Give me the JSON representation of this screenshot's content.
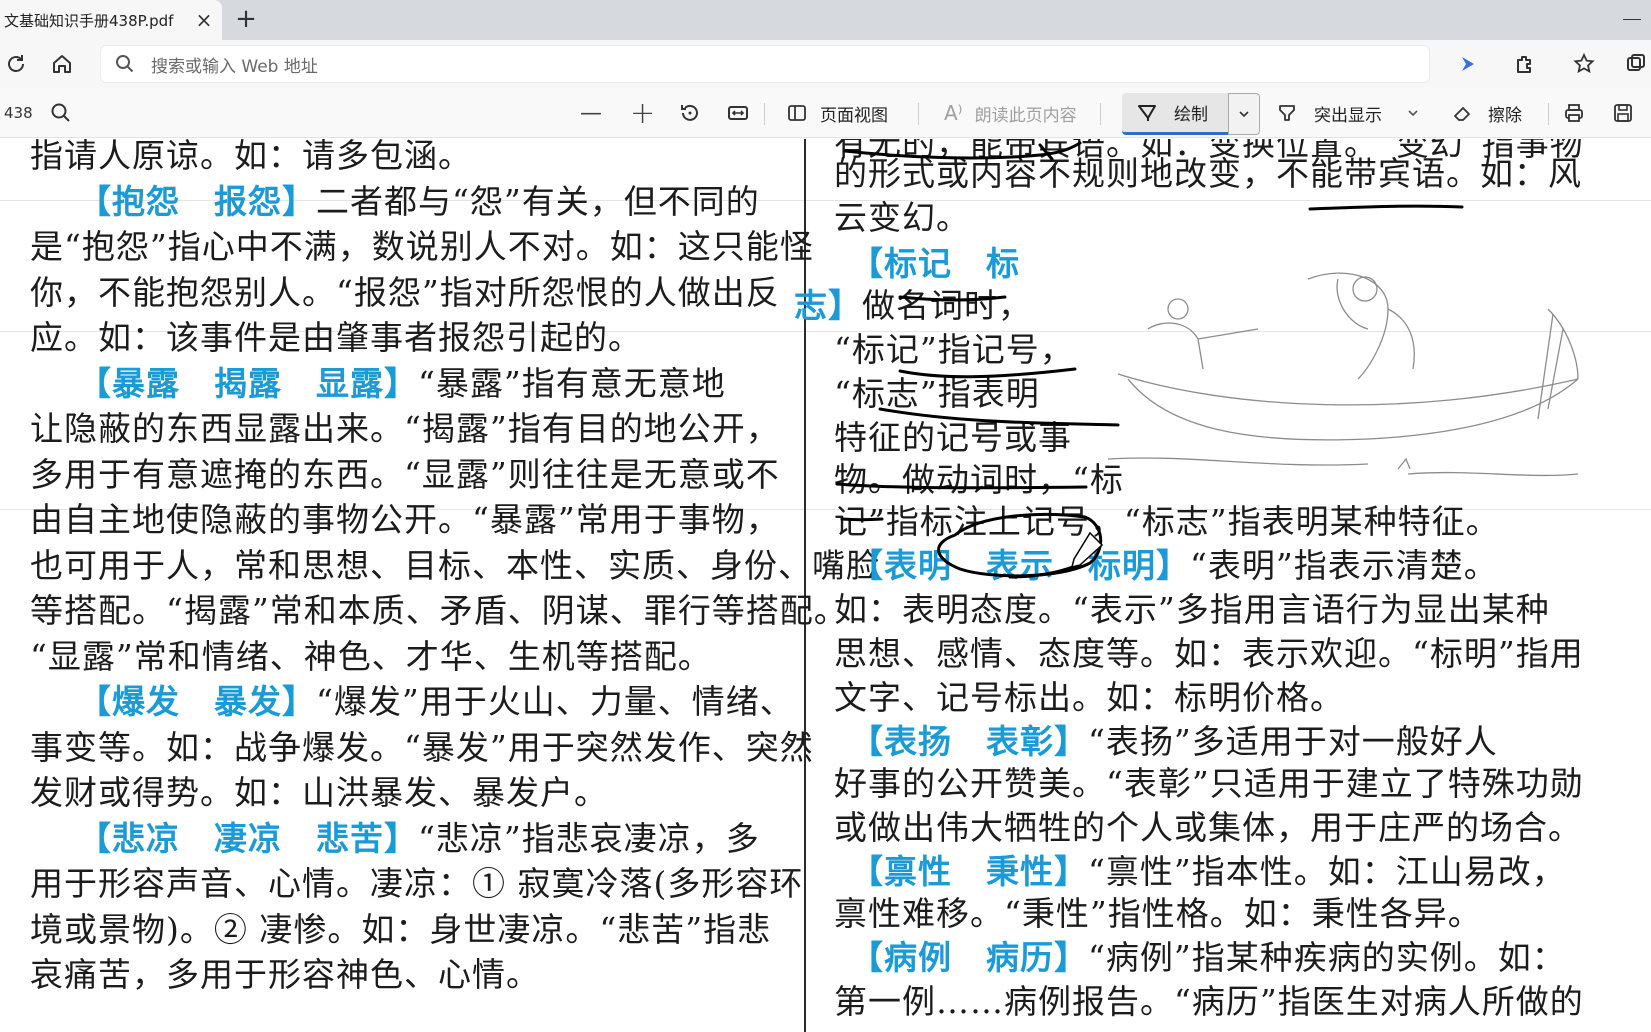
{
  "tab": {
    "title": "文基础知识手册438P.pdf",
    "close": "×",
    "new_tab": "+"
  },
  "address": {
    "placeholder": "搜索或输入 Web 地址"
  },
  "pdf_toolbar": {
    "page_count": "438",
    "zoom_out": "—",
    "zoom_in": "+",
    "page_view": "页面视图",
    "read_aloud": "朗读此页内容",
    "draw": "绘制",
    "highlight": "突出显示",
    "erase": "擦除"
  },
  "left_column": [
    {
      "text": "指请人原谅。如：请多包涵。"
    },
    {
      "head": "【抱怨　报怨】",
      "text": "二者都与“怨”有关，但不同的"
    },
    {
      "text": "是“抱怨”指心中不满，数说别人不对。如：这只能怪"
    },
    {
      "text": "你，不能抱怨别人。“报怨”指对所怨恨的人做出反"
    },
    {
      "text": "应。如：该事件是由肇事者报怨引起的。"
    },
    {
      "head": "【暴露　揭露　显露】",
      "text": "“暴露”指有意无意地"
    },
    {
      "text": "让隐蔽的东西显露出来。“揭露”指有目的地公开，"
    },
    {
      "text": "多用于有意遮掩的东西。“显露”则往往是无意或不"
    },
    {
      "text": "由自主地使隐蔽的事物公开。“暴露”常用于事物，"
    },
    {
      "text": "也可用于人，常和思想、目标、本性、实质、身份、嘴脸"
    },
    {
      "text": "等搭配。“揭露”常和本质、矛盾、阴谋、罪行等搭配。"
    },
    {
      "text": "“显露”常和情绪、神色、才华、生机等搭配。"
    },
    {
      "head": "【爆发　暴发】",
      "text": "“爆发”用于火山、力量、情绪、"
    },
    {
      "text": "事变等。如：战争爆发。“暴发”用于突然发作、突然"
    },
    {
      "text": "发财或得势。如：山洪暴发、暴发户。"
    },
    {
      "head": "【悲凉　凄凉　悲苦】",
      "text": "“悲凉”指悲哀凄凉，多"
    },
    {
      "text": "用于形容声音、心情。凄凉：① 寂寞冷落(多形容环"
    },
    {
      "text": "境或景物)。② 凄惨。如：身世凄凉。“悲苦”指悲"
    },
    {
      "text": "哀痛苦，多用于形容神色、心情。"
    }
  ],
  "right_column": [
    {
      "text": "有无的，能带宾语。如：变换位置。“变幻”指事物"
    },
    {
      "text": "的形式或内容不规则地改变，不能带宾语。如：风"
    },
    {
      "text": "云变幻。"
    },
    {
      "head": "【标记　标",
      "text": ""
    },
    {
      "head": "志】",
      "text": "做名词时，"
    },
    {
      "text": "“标记”指记号，"
    },
    {
      "text": "“标志”指表明"
    },
    {
      "text": "特征的记号或事"
    },
    {
      "text": "物。做动词时，“标"
    },
    {
      "text": "记”指标注上记号，“标志”指表明某种特征。"
    },
    {
      "head": "【表明　表示　标明】",
      "text": "“表明”指表示清楚。"
    },
    {
      "text": "如：表明态度。“表示”多指用言语行为显出某种"
    },
    {
      "text": "思想、感情、态度等。如：表示欢迎。“标明”指用"
    },
    {
      "text": "文字、记号标出。如：标明价格。"
    },
    {
      "head": "【表扬　表彰】",
      "text": "“表扬”多适用于对一般好人"
    },
    {
      "text": "好事的公开赞美。“表彰”只适用于建立了特殊功勋"
    },
    {
      "text": "或做出伟大牺牲的个人或集体，用于庄严的场合。"
    },
    {
      "head": "【禀性　秉性】",
      "text": "“禀性”指本性。如：江山易改，"
    },
    {
      "text": "禀性难移。“秉性”指性格。如：秉性各异。"
    },
    {
      "head": "【病例　病历】",
      "text": "“病例”指某种疾病的实例。如："
    },
    {
      "text": "第一例……病例报告。“病历”指医生对病人所做的"
    }
  ],
  "colors": {
    "heading": "#1a9bd7",
    "ink": "#000000",
    "accent": "#2b6fce"
  }
}
